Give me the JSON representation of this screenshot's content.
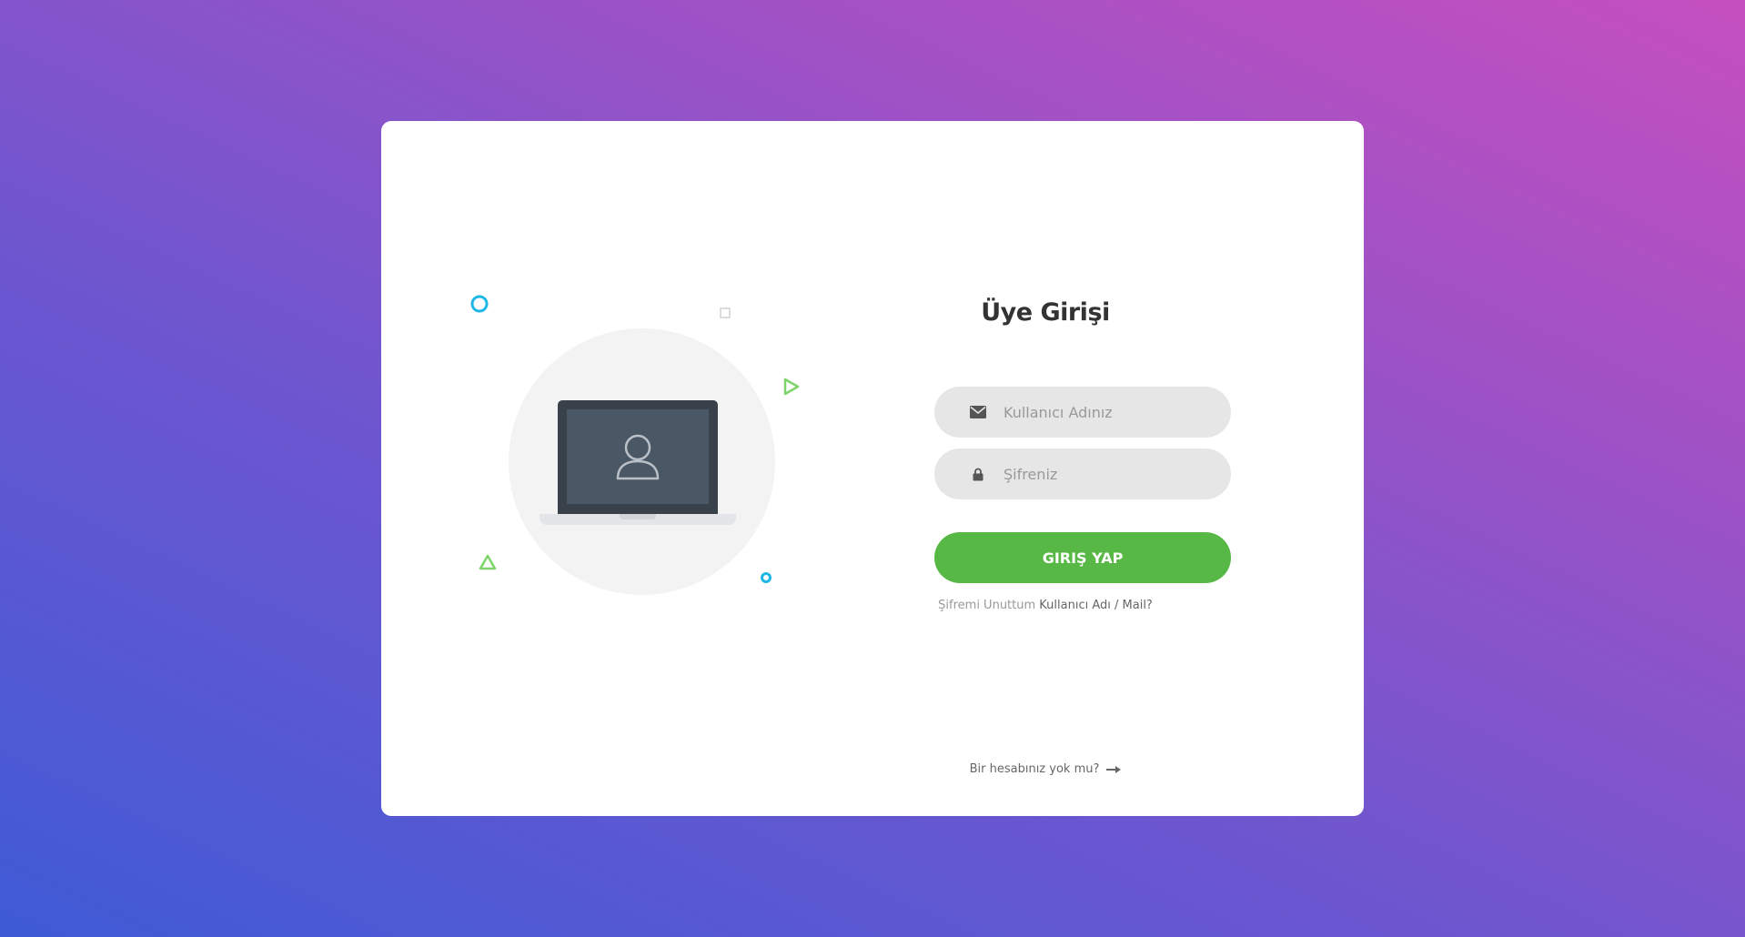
{
  "login": {
    "title": "Üye Girişi",
    "username": {
      "placeholder": "Kullanıcı Adınız",
      "icon": "envelope-icon"
    },
    "password": {
      "placeholder": "Şifreniz",
      "icon": "lock-icon"
    },
    "submit_label": "GIRIŞ YAP",
    "forgot_prefix": "Şifremi Unuttum",
    "forgot_link": "Kullanıcı Adı / Mail?",
    "signup_label": "Bir hesabınız yok mu?",
    "signup_icon": "arrow-right-icon"
  },
  "illustration": {
    "icon": "laptop-user-icon"
  },
  "colors": {
    "accent": "#57b846",
    "field_bg": "#e6e6e6",
    "card_bg": "#ffffff",
    "gradient_start": "#3f5bd6",
    "gradient_end": "#c54fbf",
    "deco_blue": "#1fb8e6",
    "deco_green": "#7ed46a"
  }
}
